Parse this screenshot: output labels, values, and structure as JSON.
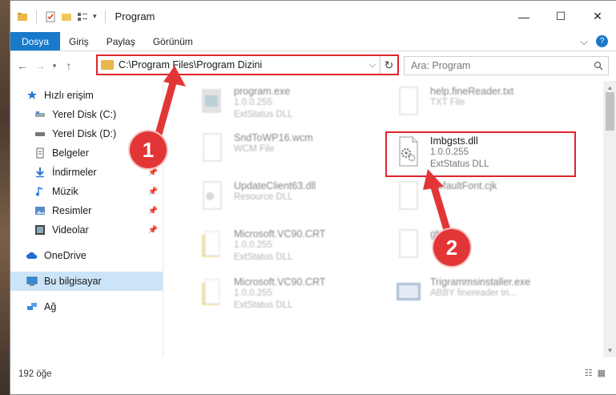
{
  "window": {
    "title": "Program",
    "minimize": "—",
    "maximize": "☐",
    "close": "✕"
  },
  "ribbon": {
    "tabs": [
      "Dosya",
      "Giriş",
      "Paylaş",
      "Görünüm"
    ],
    "chevron": "⌵",
    "help": "?"
  },
  "address": {
    "path": "C:\\Program Files\\Program Dizini",
    "search_placeholder": "Ara: Program"
  },
  "sidebar": {
    "items": [
      {
        "label": "Hızlı erişim",
        "icon": "star-icon",
        "pinned": false
      },
      {
        "label": "Yerel Disk (C:)",
        "icon": "drive-icon",
        "pinned": false
      },
      {
        "label": "Yerel Disk (D:)",
        "icon": "drive-icon",
        "pinned": false
      },
      {
        "label": "Belgeler",
        "icon": "documents-icon",
        "pinned": false
      },
      {
        "label": "İndirmeler",
        "icon": "download-icon",
        "pinned": true
      },
      {
        "label": "Müzik",
        "icon": "music-icon",
        "pinned": true
      },
      {
        "label": "Resimler",
        "icon": "pictures-icon",
        "pinned": true
      },
      {
        "label": "Videolar",
        "icon": "videos-icon",
        "pinned": true
      },
      {
        "label": "OneDrive",
        "icon": "cloud-icon",
        "pinned": false
      },
      {
        "label": "Bu bilgisayar",
        "icon": "computer-icon",
        "pinned": false
      },
      {
        "label": "Ağ",
        "icon": "network-icon",
        "pinned": false
      }
    ]
  },
  "files": [
    {
      "name": "program.exe",
      "line1": "1.0.0.255",
      "line2": "ExtStatus DLL"
    },
    {
      "name": "help.fineReader.txt",
      "line1": "TXT File",
      "line2": ""
    },
    {
      "name": "SndToWP16.wcm",
      "line1": "WCM File",
      "line2": ""
    },
    {
      "name": "Imbgsts.dll",
      "line1": "1.0.0.255",
      "line2": "ExtStatus DLL"
    },
    {
      "name": "UpdateClient63.dll",
      "line1": "Resource DLL",
      "line2": ""
    },
    {
      "name": "DefaultFont.cjk",
      "line1": "",
      "line2": ""
    },
    {
      "name": "Microsoft.VC90.CRT",
      "line1": "1.0.0.255",
      "line2": "ExtStatus DLL"
    },
    {
      "name": "gbdt",
      "line1": "",
      "line2": ""
    },
    {
      "name": "Microsoft.VC90.CRT",
      "line1": "1.0.0.255",
      "line2": "ExtStatus DLL"
    },
    {
      "name": "Trigrammsinstaller.exe",
      "line1": "ABBY finereader tri...",
      "line2": ""
    }
  ],
  "status": {
    "count": "192 öğe"
  },
  "annotations": {
    "step1": "1",
    "step2": "2"
  },
  "colors": {
    "accent": "#1979ca",
    "highlight": "#e0242c",
    "badge": "#e23636"
  }
}
